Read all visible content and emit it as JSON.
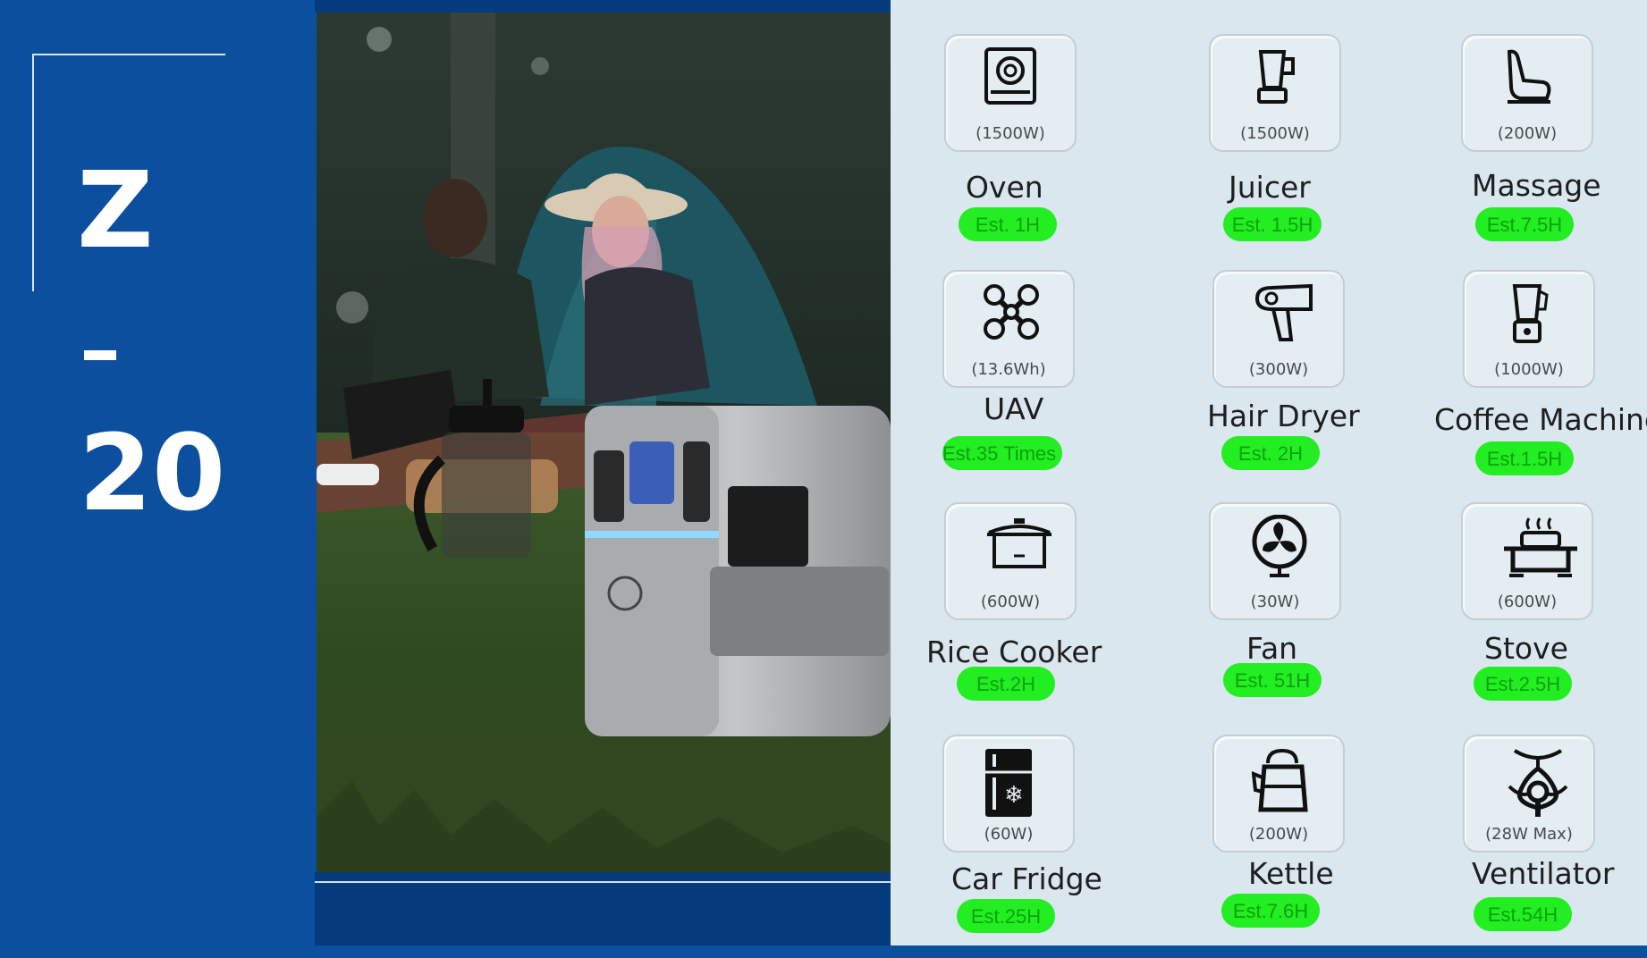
{
  "model": {
    "letter": "Z",
    "dash": "-",
    "number": "20"
  },
  "colors": {
    "panel_blue": "#0b4f9e",
    "dark_blue": "#053a7c",
    "grid_bg": "#dae7ef",
    "badge_green": "#22ee22",
    "badge_text": "#0ea00e"
  },
  "appliances": [
    {
      "name": "Oven",
      "watt": "(1500W)",
      "est": "Est. 1H",
      "icon": "induction-cooker-icon"
    },
    {
      "name": "Juicer",
      "watt": "(1500W)",
      "est": "Est. 1.5H",
      "icon": "juicer-icon"
    },
    {
      "name": "Massage",
      "watt": "(200W)",
      "est": "Est.7.5H",
      "icon": "massage-seat-icon"
    },
    {
      "name": "UAV",
      "watt": "(13.6Wh)",
      "est": "Est.35 Times",
      "icon": "drone-icon"
    },
    {
      "name": "Hair Dryer",
      "watt": "(300W)",
      "est": "Est. 2H",
      "icon": "hair-dryer-icon"
    },
    {
      "name": "Coffee Machine",
      "watt": "(1000W)",
      "est": "Est.1.5H",
      "icon": "blender-icon"
    },
    {
      "name": "Rice Cooker",
      "watt": "(600W)",
      "est": "Est.2H",
      "icon": "rice-cooker-icon"
    },
    {
      "name": "Fan",
      "watt": "(30W)",
      "est": "Est. 51H",
      "icon": "fan-icon"
    },
    {
      "name": "Stove",
      "watt": "(600W)",
      "est": "Est.2.5H",
      "icon": "stove-icon"
    },
    {
      "name": "Car Fridge",
      "watt": "(60W)",
      "est": "Est.25H",
      "icon": "fridge-icon"
    },
    {
      "name": "Kettle",
      "watt": "(200W)",
      "est": "Est.7.6H",
      "icon": "kettle-icon"
    },
    {
      "name": "Ventilator",
      "watt": "(28W Max)",
      "est": "Est.54H",
      "icon": "ventilator-mask-icon"
    }
  ]
}
